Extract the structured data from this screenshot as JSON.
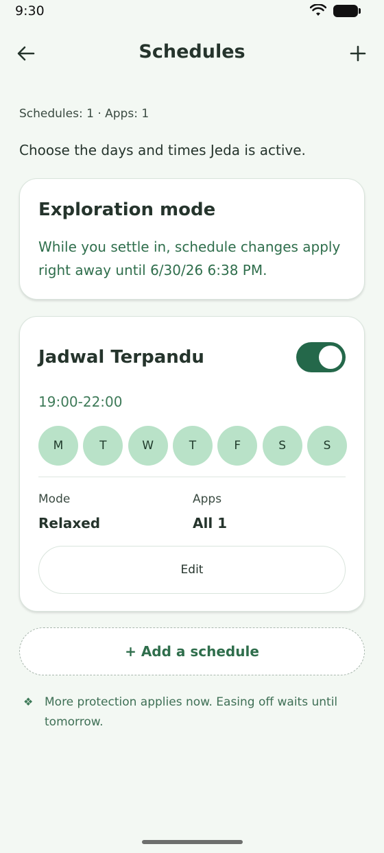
{
  "status_bar": {
    "time": "9:30"
  },
  "header": {
    "title": "Schedules"
  },
  "summary": "Schedules: 1 · Apps: 1",
  "intro": "Choose the days and times Jeda is active.",
  "exploration": {
    "title": "Exploration mode",
    "body": "While you settle in, schedule changes apply right away until 6/30/26 6:38 PM."
  },
  "schedule": {
    "name": "Jadwal Terpandu",
    "enabled": true,
    "time_range": "19:00-22:00",
    "days": [
      "M",
      "T",
      "W",
      "T",
      "F",
      "S",
      "S"
    ],
    "mode_label": "Mode",
    "mode_value": "Relaxed",
    "apps_label": "Apps",
    "apps_value": "All 1",
    "edit_label": "Edit"
  },
  "add_schedule_label": "+ Add a schedule",
  "note": {
    "icon": "diamond-sparkle-icon",
    "text": "More protection applies now. Easing off waits until tomorrow."
  },
  "colors": {
    "background": "#f3f8f3",
    "accent": "#24684a",
    "day_chip": "#b9e2c8",
    "accent_text": "#2f6e4c"
  }
}
